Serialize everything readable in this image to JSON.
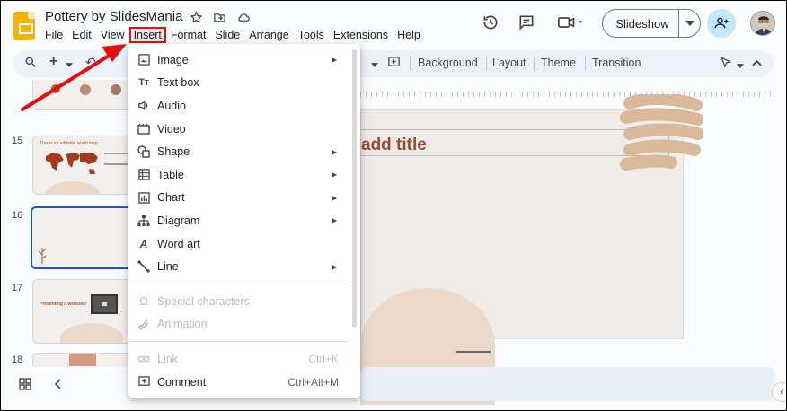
{
  "app": {
    "doc_title": "Pottery by SlidesMania",
    "brand_color": "#f4b400"
  },
  "menubar": {
    "items": [
      "File",
      "Edit",
      "View",
      "Insert",
      "Format",
      "Slide",
      "Arrange",
      "Tools",
      "Extensions",
      "Help"
    ],
    "active": "Insert"
  },
  "header": {
    "slideshow_label": "Slideshow",
    "icons": [
      "history-icon",
      "comment-icon",
      "video-call-icon",
      "share-icon",
      "account-icon"
    ]
  },
  "toolbar": {
    "background_label": "Background",
    "layout_label": "Layout",
    "theme_label": "Theme",
    "transition_label": "Transition"
  },
  "filmstrip": {
    "slides": [
      {
        "number": "15",
        "title": "This is an editable world map"
      },
      {
        "number": "16",
        "title": ""
      },
      {
        "number": "17",
        "title": "Presenting a website?"
      },
      {
        "number": "18",
        "title": ""
      }
    ],
    "selected": "16"
  },
  "canvas": {
    "title_text": "add title",
    "title_color": "#9a4a30"
  },
  "insert_menu": {
    "items": [
      {
        "label": "Image",
        "icon": "image-icon",
        "submenu": true,
        "disabled": false,
        "shortcut": ""
      },
      {
        "label": "Text box",
        "icon": "text-box-icon",
        "submenu": false,
        "disabled": false,
        "shortcut": ""
      },
      {
        "label": "Audio",
        "icon": "audio-icon",
        "submenu": false,
        "disabled": false,
        "shortcut": ""
      },
      {
        "label": "Video",
        "icon": "video-icon",
        "submenu": false,
        "disabled": false,
        "shortcut": ""
      },
      {
        "label": "Shape",
        "icon": "shape-icon",
        "submenu": true,
        "disabled": false,
        "shortcut": ""
      },
      {
        "label": "Table",
        "icon": "table-icon",
        "submenu": true,
        "disabled": false,
        "shortcut": ""
      },
      {
        "label": "Chart",
        "icon": "chart-icon",
        "submenu": true,
        "disabled": false,
        "shortcut": ""
      },
      {
        "label": "Diagram",
        "icon": "diagram-icon",
        "submenu": true,
        "disabled": false,
        "shortcut": ""
      },
      {
        "label": "Word art",
        "icon": "word-art-icon",
        "submenu": false,
        "disabled": false,
        "shortcut": ""
      },
      {
        "label": "Line",
        "icon": "line-icon",
        "submenu": true,
        "disabled": false,
        "shortcut": ""
      },
      {
        "label": "Special characters",
        "icon": "special-characters-icon",
        "submenu": false,
        "disabled": true,
        "shortcut": ""
      },
      {
        "label": "Animation",
        "icon": "animation-icon",
        "submenu": false,
        "disabled": true,
        "shortcut": ""
      },
      {
        "label": "Link",
        "icon": "link-icon",
        "submenu": false,
        "disabled": true,
        "shortcut": "Ctrl+K"
      },
      {
        "label": "Comment",
        "icon": "comment-add-icon",
        "submenu": false,
        "disabled": false,
        "shortcut": "Ctrl+Alt+M"
      }
    ]
  },
  "annotation": {
    "highlight_color": "#e01010"
  }
}
